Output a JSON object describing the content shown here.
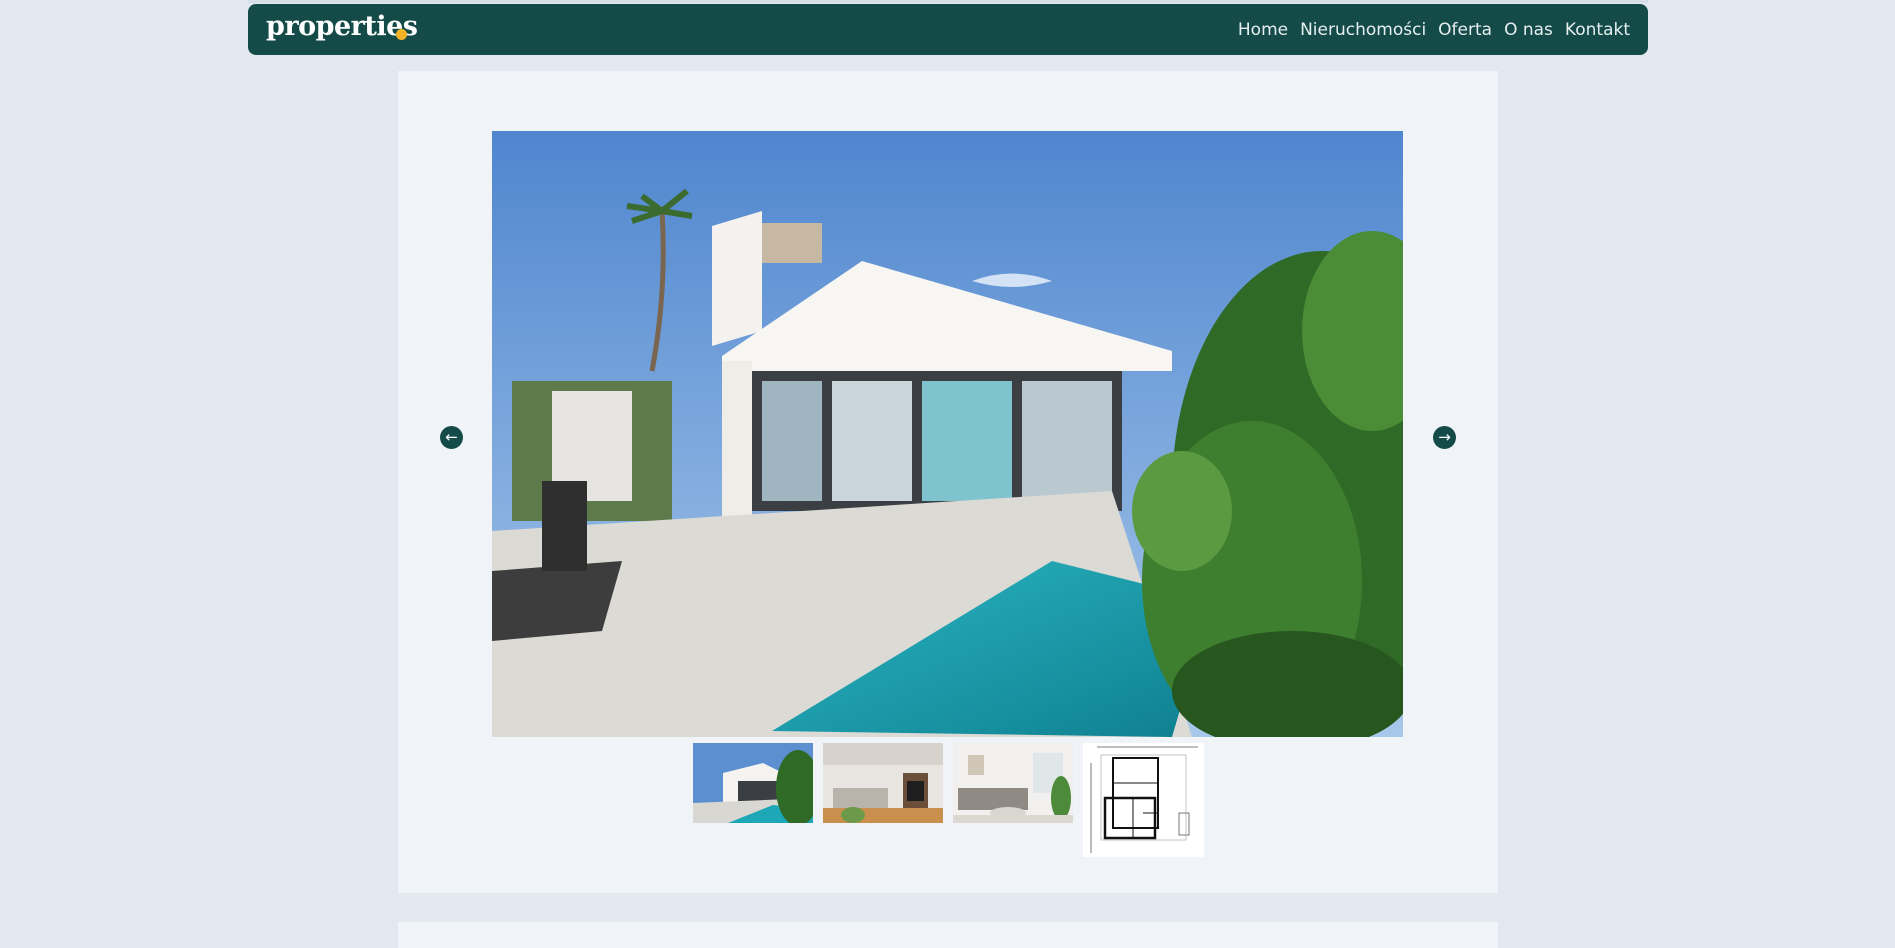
{
  "header": {
    "logo_text": "properties",
    "logo_dot_color": "#f4b324",
    "brand_color": "#144b48",
    "nav": [
      {
        "label": "Home"
      },
      {
        "label": "Nieruchomości"
      },
      {
        "label": "Oferta"
      },
      {
        "label": "O nas"
      },
      {
        "label": "Kontakt"
      }
    ]
  },
  "gallery": {
    "prev_icon": "arrow-left-circle-icon",
    "next_icon": "arrow-right-circle-icon",
    "thumbnails": [
      {
        "name": "house-exterior-pool"
      },
      {
        "name": "living-room-fireplace"
      },
      {
        "name": "living-room-sofa"
      },
      {
        "name": "floor-plan"
      }
    ]
  }
}
